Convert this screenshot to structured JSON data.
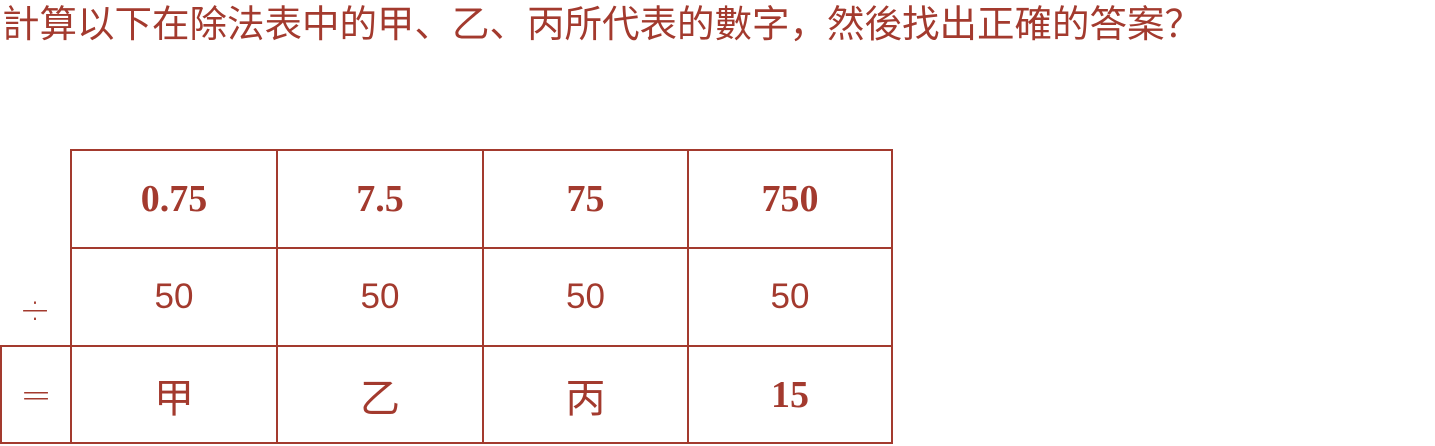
{
  "question": "計算以下在除法表中的甲、乙、丙所代表的數字，然後找出正確的答案？",
  "table": {
    "dividends": [
      "0.75",
      "7.5",
      "75",
      "750"
    ],
    "divide_symbol": "÷",
    "divisors": [
      "50",
      "50",
      "50",
      "50"
    ],
    "equals_symbol": "=",
    "results": [
      "甲",
      "乙",
      "丙",
      "15"
    ]
  },
  "colors": {
    "accent": "#a33a2e",
    "background": "#ffffff"
  }
}
